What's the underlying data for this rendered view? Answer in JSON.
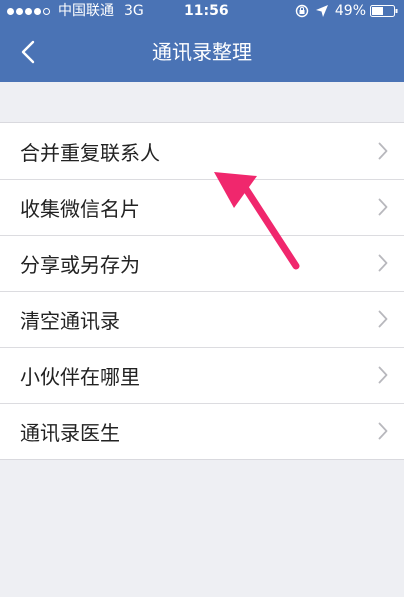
{
  "status_bar": {
    "carrier": "中国联通",
    "network": "3G",
    "time": "11:56",
    "battery": "49%"
  },
  "nav": {
    "title": "通讯录整理",
    "back_icon": "chevron-left-icon"
  },
  "menu": {
    "items": [
      {
        "label": "合并重复联系人"
      },
      {
        "label": "收集微信名片"
      },
      {
        "label": "分享或另存为"
      },
      {
        "label": "清空通讯录"
      },
      {
        "label": "小伙伴在哪里"
      },
      {
        "label": "通讯录医生"
      }
    ]
  },
  "colors": {
    "nav_bg": "#4a73b5",
    "page_bg": "#eeeff3",
    "arrow": "#f0276d"
  }
}
